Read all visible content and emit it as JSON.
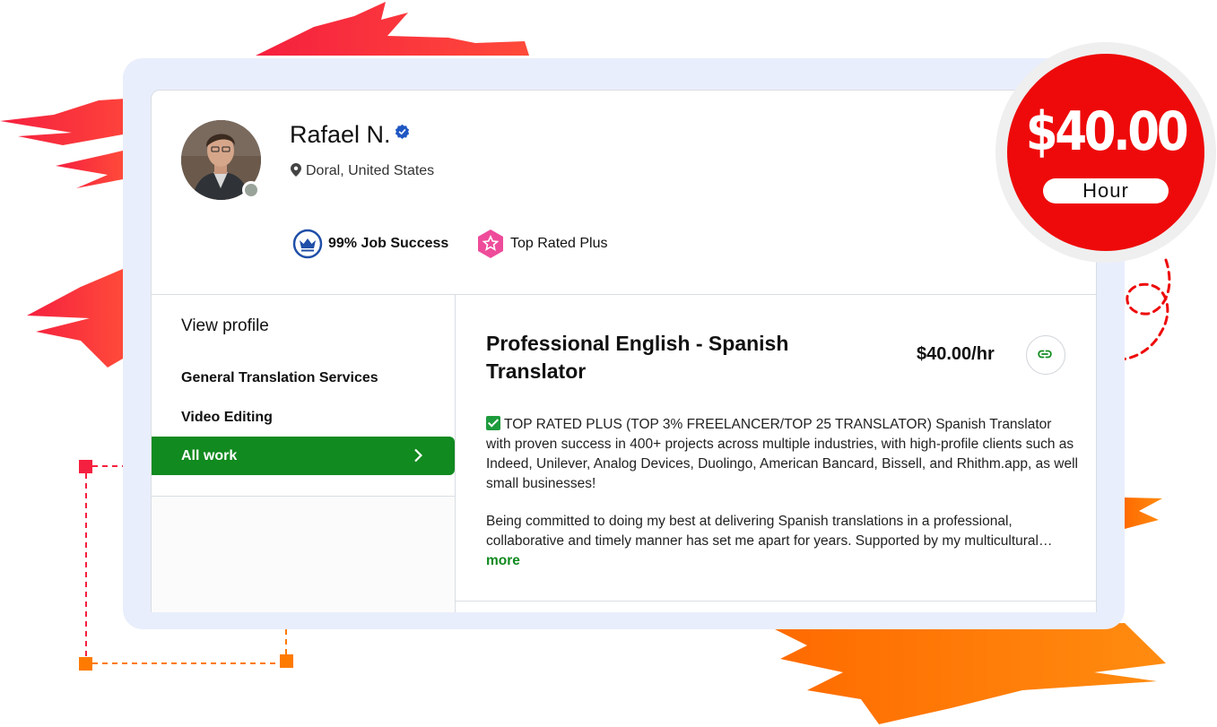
{
  "profile": {
    "name": "Rafael N.",
    "location": "Doral, United States",
    "job_success": "99% Job Success",
    "badge": "Top Rated Plus"
  },
  "sidebar": {
    "title": "View profile",
    "items": [
      "General Translation Services",
      "Video Editing"
    ],
    "active_item": "All work"
  },
  "job": {
    "title": "Professional English - Spanish Translator",
    "rate": "$40.00/hr",
    "description_1": "TOP RATED PLUS (TOP 3% FREELANCER/TOP 25 TRANSLATOR) Spanish Translator with proven success in 400+ projects across multiple industries, with high-profile clients such as Indeed, Unilever, Analog Devices, Duolingo, American Bancard, Bissell, and Rhithm.app, as well small businesses!",
    "description_2": "Being committed to doing my best at delivering Spanish translations in a professional, collaborative and timely manner has set me apart for years. Supported by my multicultural…",
    "more_label": "more"
  },
  "price_badge": {
    "amount": "$40.00",
    "unit": "Hour"
  },
  "colors": {
    "accent_green": "#118a1f",
    "badge_red": "#ee0a0a",
    "frame_blue": "#e9eefc",
    "verified_blue": "#1f57c3",
    "top_rated_pink": "#ee4c9a",
    "brush_red": "#f5203f",
    "brush_orange": "#ff7a00"
  }
}
